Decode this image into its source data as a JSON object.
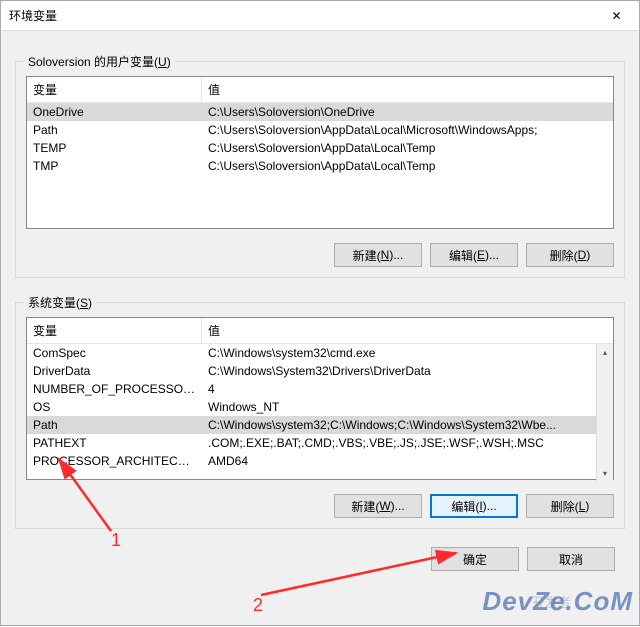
{
  "window": {
    "title": "环境变量"
  },
  "user_vars": {
    "label_before": "Soloversion 的用户变量(",
    "label_u": "U",
    "label_after": ")",
    "col_name": "变量",
    "col_value": "值",
    "rows": [
      {
        "name": "OneDrive",
        "value": "C:\\Users\\Soloversion\\OneDrive"
      },
      {
        "name": "Path",
        "value": "C:\\Users\\Soloversion\\AppData\\Local\\Microsoft\\WindowsApps;"
      },
      {
        "name": "TEMP",
        "value": "C:\\Users\\Soloversion\\AppData\\Local\\Temp"
      },
      {
        "name": "TMP",
        "value": "C:\\Users\\Soloversion\\AppData\\Local\\Temp"
      }
    ],
    "btn_new_before": "新建(",
    "btn_new_u": "N",
    "btn_new_after": ")...",
    "btn_edit_before": "编辑(",
    "btn_edit_u": "E",
    "btn_edit_after": ")...",
    "btn_del_before": "删除(",
    "btn_del_u": "D",
    "btn_del_after": ")"
  },
  "sys_vars": {
    "label_before": "系统变量(",
    "label_u": "S",
    "label_after": ")",
    "col_name": "变量",
    "col_value": "值",
    "rows": [
      {
        "name": "ComSpec",
        "value": "C:\\Windows\\system32\\cmd.exe"
      },
      {
        "name": "DriverData",
        "value": "C:\\Windows\\System32\\Drivers\\DriverData"
      },
      {
        "name": "NUMBER_OF_PROCESSORS",
        "value": "4"
      },
      {
        "name": "OS",
        "value": "Windows_NT"
      },
      {
        "name": "Path",
        "value": "C:\\Windows\\system32;C:\\Windows;C:\\Windows\\System32\\Wbe..."
      },
      {
        "name": "PATHEXT",
        "value": ".COM;.EXE;.BAT;.CMD;.VBS;.VBE;.JS;.JSE;.WSF;.WSH;.MSC"
      },
      {
        "name": "PROCESSOR_ARCHITECTURE",
        "value": "AMD64"
      }
    ],
    "btn_new_before": "新建(",
    "btn_new_u": "W",
    "btn_new_after": ")...",
    "btn_edit_before": "编辑(",
    "btn_edit_u": "I",
    "btn_edit_after": ")...",
    "btn_del_before": "删除(",
    "btn_del_u": "L",
    "btn_del_after": ")"
  },
  "footer": {
    "ok": "确定",
    "cancel": "取消"
  },
  "annotations": {
    "n1": "1",
    "n2": "2"
  },
  "watermark": {
    "main": "DevZe.CoM",
    "sub": "开发者"
  }
}
